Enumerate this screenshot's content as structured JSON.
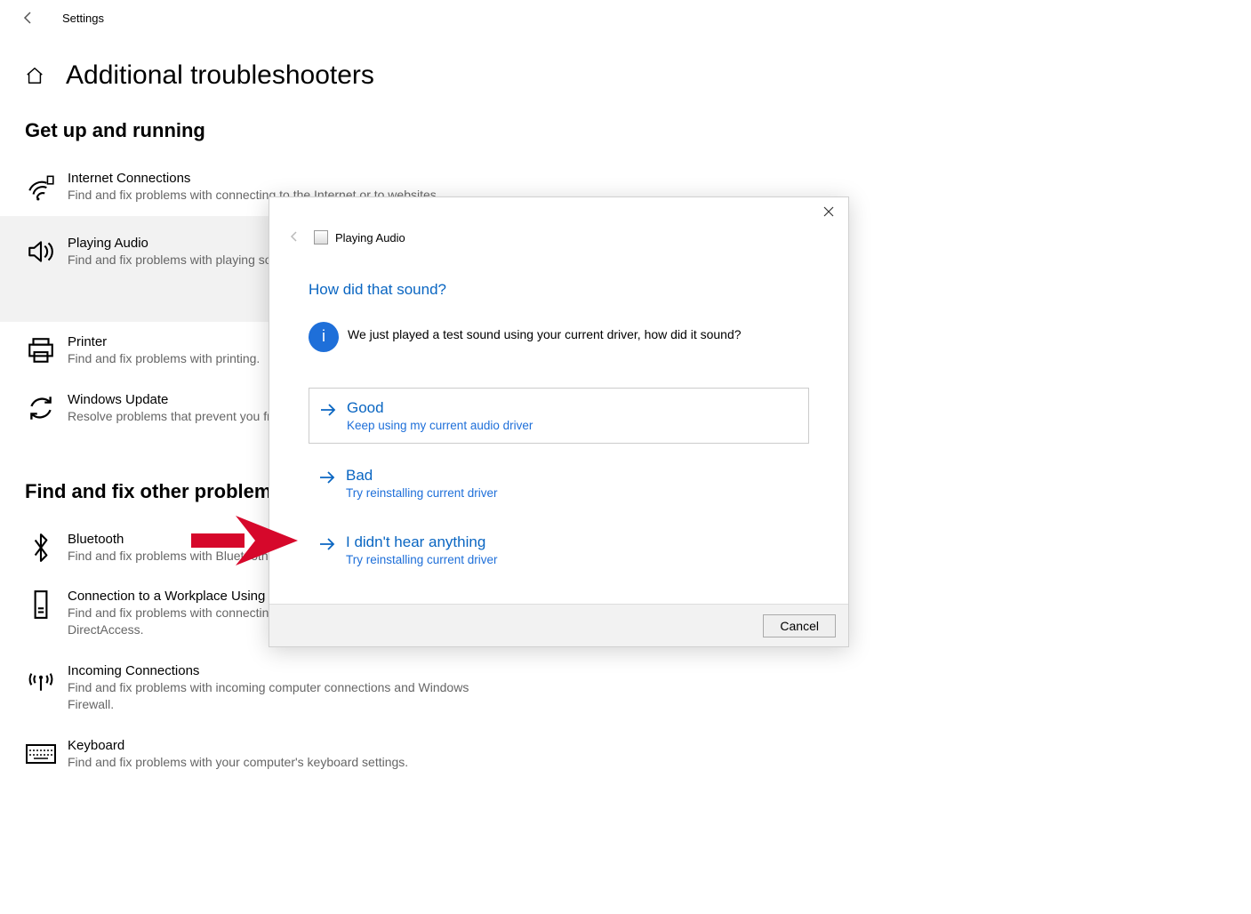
{
  "header": {
    "app_title": "Settings",
    "page_title": "Additional troubleshooters"
  },
  "sections": {
    "getup_heading": "Get up and running",
    "other_heading": "Find and fix other problems"
  },
  "troubleshooters_getup": [
    {
      "title": "Internet Connections",
      "desc": "Find and fix problems with connecting to the Internet or to websites."
    },
    {
      "title": "Playing Audio",
      "desc": "Find and fix problems with playing sound."
    },
    {
      "title": "Printer",
      "desc": "Find and fix problems with printing."
    },
    {
      "title": "Windows Update",
      "desc": "Resolve problems that prevent you from updating Windows."
    }
  ],
  "troubleshooters_other": [
    {
      "title": "Bluetooth",
      "desc": "Find and fix problems with Bluetooth devices."
    },
    {
      "title": "Connection to a Workplace Using DirectAccess",
      "desc": "Find and fix problems with connecting to your workplace network using DirectAccess."
    },
    {
      "title": "Incoming Connections",
      "desc": "Find and fix problems with incoming computer connections and Windows Firewall."
    },
    {
      "title": "Keyboard",
      "desc": "Find and fix problems with your computer's keyboard settings."
    }
  ],
  "dialog": {
    "title": "Playing Audio",
    "question": "How did that sound?",
    "info_badge": "i",
    "message": "We just played a test sound using your current driver, how did it sound?",
    "options": [
      {
        "title": "Good",
        "sub": "Keep using my current audio driver"
      },
      {
        "title": "Bad",
        "sub": "Try reinstalling current driver"
      },
      {
        "title": "I didn't hear anything",
        "sub": "Try reinstalling current driver"
      }
    ],
    "cancel": "Cancel"
  }
}
